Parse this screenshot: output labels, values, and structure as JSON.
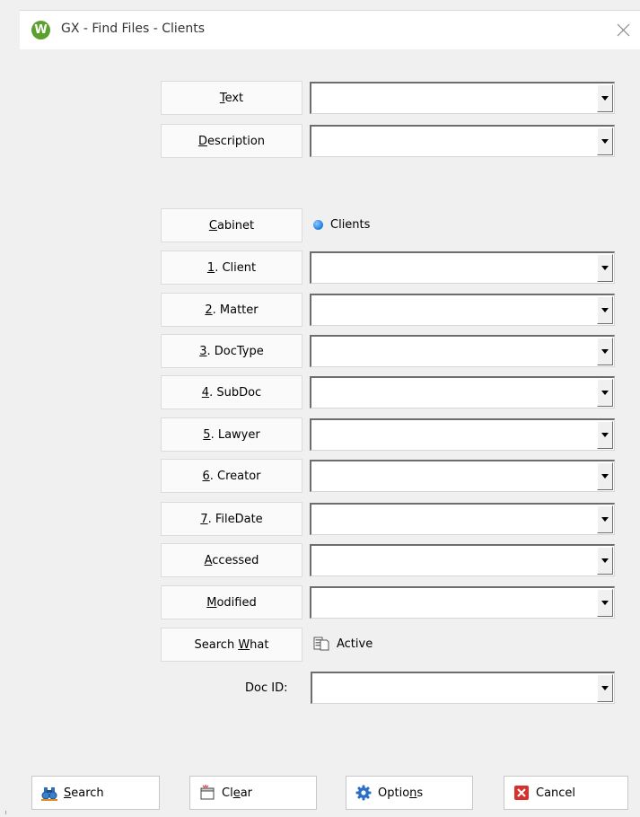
{
  "window": {
    "title": "GX - Find Files - Clients",
    "logo_letter": "W",
    "close_glyph": "×"
  },
  "fields": {
    "text": {
      "label": "Text",
      "mnemonic_pre": "",
      "mnemonic": "T",
      "mnemonic_post": "ext",
      "value": ""
    },
    "description": {
      "label": "Description",
      "mnemonic_pre": "",
      "mnemonic": "D",
      "mnemonic_post": "escription",
      "value": ""
    },
    "cabinet": {
      "label": "Cabinet",
      "mnemonic_pre": "",
      "mnemonic": "C",
      "mnemonic_post": "abinet",
      "value": "Clients"
    },
    "client": {
      "label": "1. Client",
      "mnemonic_pre": "",
      "mnemonic": "1",
      "mnemonic_post": ". Client",
      "value": ""
    },
    "matter": {
      "label": "2. Matter",
      "mnemonic_pre": "",
      "mnemonic": "2",
      "mnemonic_post": ". Matter",
      "value": ""
    },
    "doctype": {
      "label": "3. DocType",
      "mnemonic_pre": "",
      "mnemonic": "3",
      "mnemonic_post": ". DocType",
      "value": ""
    },
    "subdoc": {
      "label": "4. SubDoc",
      "mnemonic_pre": "",
      "mnemonic": "4",
      "mnemonic_post": ". SubDoc",
      "value": ""
    },
    "lawyer": {
      "label": "5. Lawyer",
      "mnemonic_pre": "",
      "mnemonic": "5",
      "mnemonic_post": ". Lawyer",
      "value": ""
    },
    "creator": {
      "label": "6. Creator",
      "mnemonic_pre": "",
      "mnemonic": "6",
      "mnemonic_post": ". Creator",
      "value": ""
    },
    "filedate": {
      "label": "7. FileDate",
      "mnemonic_pre": "",
      "mnemonic": "7",
      "mnemonic_post": ". FileDate",
      "value": ""
    },
    "accessed": {
      "label": "Accessed",
      "mnemonic_pre": "",
      "mnemonic": "A",
      "mnemonic_post": "ccessed",
      "value": ""
    },
    "modified": {
      "label": "Modified",
      "mnemonic_pre": "",
      "mnemonic": "M",
      "mnemonic_post": "odified",
      "value": ""
    },
    "search_what": {
      "label": "Search What",
      "mnemonic_pre": "Search ",
      "mnemonic": "W",
      "mnemonic_post": "hat",
      "value": "Active"
    },
    "doc_id": {
      "label": "Doc ID:",
      "value": ""
    }
  },
  "buttons": {
    "search": {
      "label": "Search",
      "pre": "",
      "mnemonic": "S",
      "post": "earch",
      "icon": "binoculars-icon"
    },
    "clear": {
      "label": "Clear",
      "pre": "Cl",
      "mnemonic": "e",
      "post": "ar",
      "icon": "clear-form-icon"
    },
    "options": {
      "label": "Options",
      "pre": "Optio",
      "mnemonic": "n",
      "post": "s",
      "icon": "gear-icon"
    },
    "cancel": {
      "label": "Cancel",
      "pre": "",
      "mnemonic": "",
      "post": "Cancel",
      "icon": "cancel-x-icon"
    }
  },
  "colors": {
    "accent_blue": "#2b86e5",
    "logo_green": "#5aa02c",
    "cancel_red": "#d9302c"
  }
}
